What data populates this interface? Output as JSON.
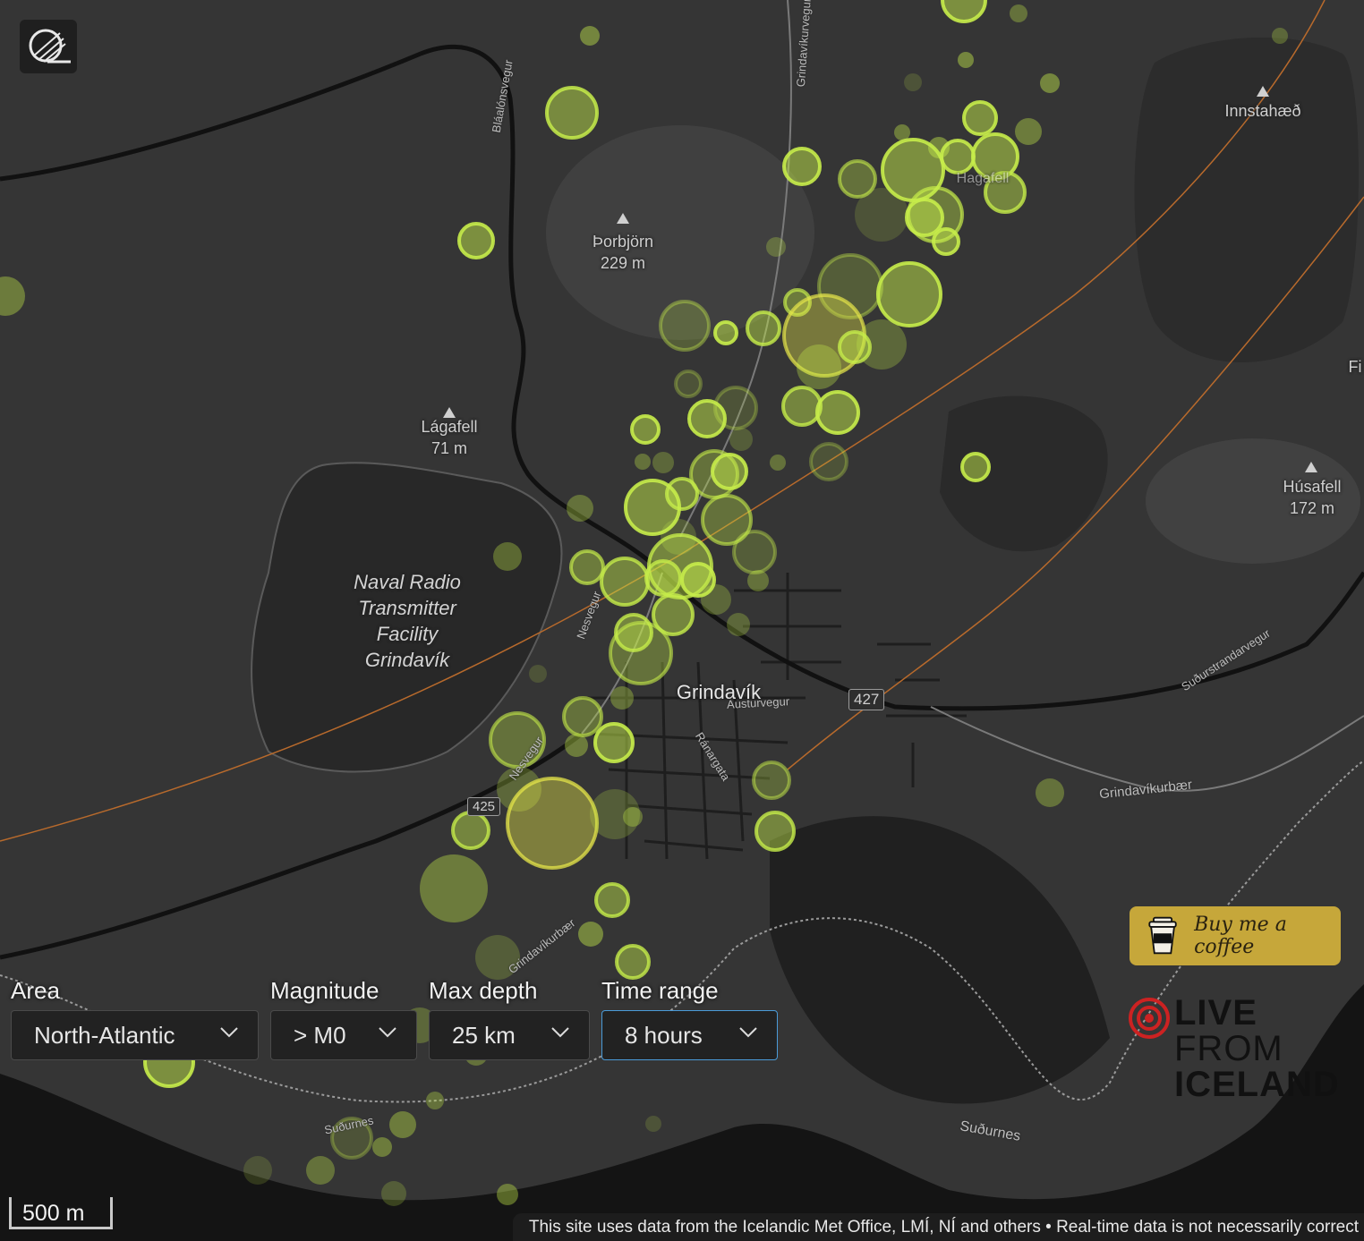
{
  "map": {
    "places": [
      {
        "name": "Þorbjörn",
        "elev": "229 m"
      },
      {
        "name": "Lágafell",
        "elev": "71 m"
      },
      {
        "name": "Innstahæð",
        "elev": ""
      },
      {
        "name": "Húsafell",
        "elev": "172 m"
      }
    ],
    "facility_label_lines": [
      "Naval Radio",
      "Transmitter",
      "Facility",
      "Grindavík"
    ],
    "town": "Grindavík",
    "partial_labels": {
      "hagafell": "Hagafell",
      "fi": "Fi"
    },
    "roads": {
      "blaalonsvegur": "Bláalónsvegur",
      "grindavikurvegur": "Grindavíkurvegur",
      "nesvegur": "Nesvegur",
      "nesvegur2": "Nesvegur",
      "austurvegur": "Austurvegur",
      "ranargata": "Ránargata",
      "sudurstrandarvegur": "Suðurstrandarvegur",
      "grindavikurbaer": "Grindavíkurbær",
      "grindavikurbaer2": "Grindavíkurbær",
      "sudurnes": "Suðurnes",
      "sudurnes2": "Suðurnes"
    },
    "shields": {
      "r427": "427",
      "r425": "425"
    },
    "quake_color": "#c6ec4a",
    "large_quake_color": "#e6e64a"
  },
  "controls": {
    "area": {
      "label": "Area",
      "value": "North-Atlantic"
    },
    "magnitude": {
      "label": "Magnitude",
      "value": "> M0"
    },
    "depth": {
      "label": "Max depth",
      "value": "25 km"
    },
    "time": {
      "label": "Time range",
      "value": "8 hours"
    }
  },
  "coffee": {
    "label": "Buy me a coffee",
    "color": "#c6a73a"
  },
  "brand": {
    "line1": "LIVE",
    "line2": "FROM",
    "line3": "ICELAND"
  },
  "scale_label": "500 m",
  "attribution": "This site uses data from the Icelandic Met Office, LMÍ, NÍ and others • Real-time data is not necessarily correct"
}
